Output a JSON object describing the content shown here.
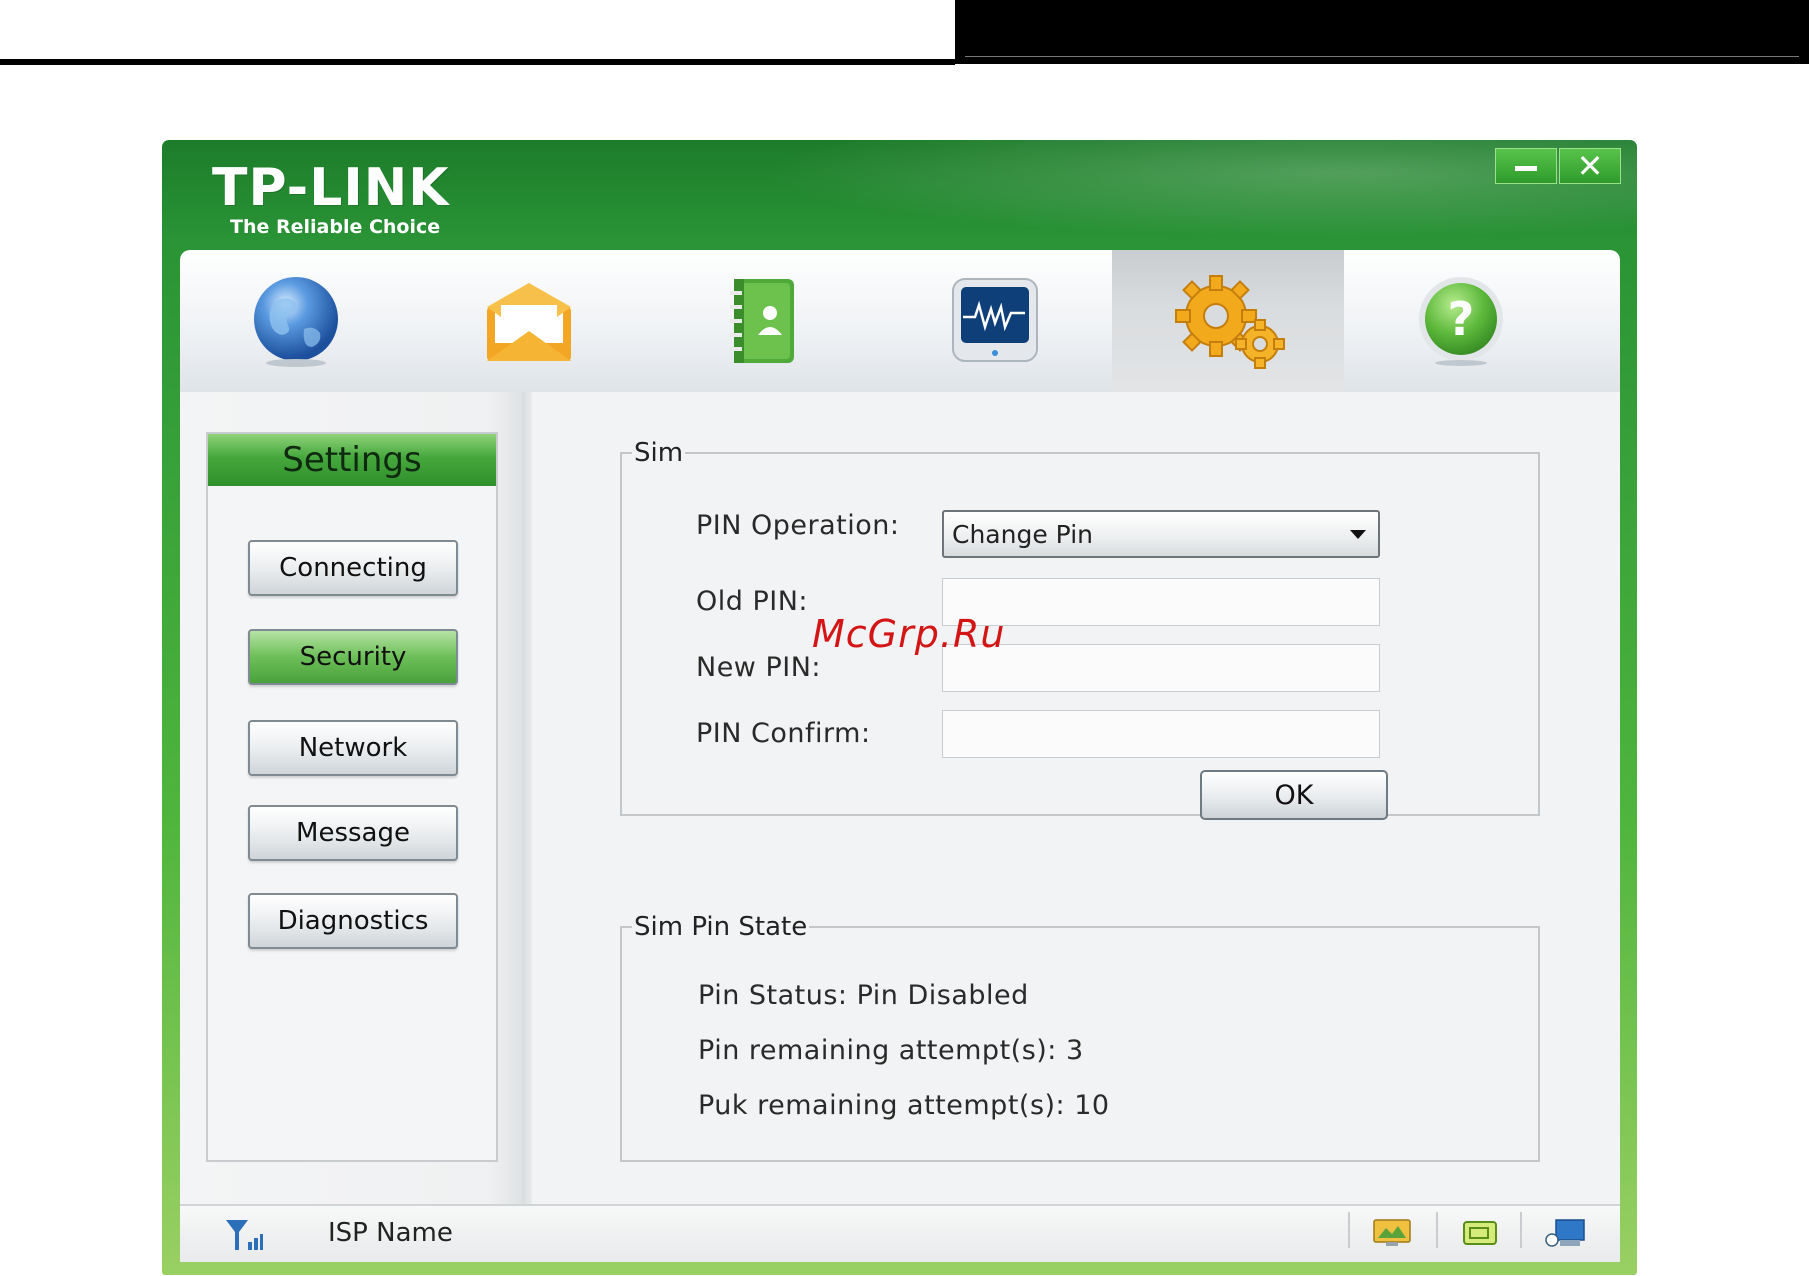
{
  "app": {
    "logo": "TP-LINK",
    "tagline": "The Reliable Choice"
  },
  "toolbar": {
    "items": [
      {
        "icon": "globe-icon",
        "active": false
      },
      {
        "icon": "envelope-icon",
        "active": false
      },
      {
        "icon": "phonebook-icon",
        "active": false
      },
      {
        "icon": "monitor-icon",
        "active": false
      },
      {
        "icon": "gears-icon",
        "active": true
      },
      {
        "icon": "help-icon",
        "active": false
      }
    ]
  },
  "sidebar": {
    "title": "Settings",
    "items": [
      {
        "label": "Connecting",
        "active": false
      },
      {
        "label": "Security",
        "active": true
      },
      {
        "label": "Network",
        "active": false
      },
      {
        "label": "Message",
        "active": false
      },
      {
        "label": "Diagnostics",
        "active": false
      }
    ]
  },
  "sim": {
    "legend": "Sim",
    "pin_operation_label": "PIN Operation:",
    "pin_operation_value": "Change Pin",
    "old_pin_label": "Old PIN:",
    "new_pin_label": "New PIN:",
    "pin_confirm_label": "PIN Confirm:",
    "ok_label": "OK"
  },
  "sim_state": {
    "legend": "Sim Pin State",
    "status_line": "Pin Status: Pin Disabled",
    "pin_remaining_line": "Pin remaining attempt(s): 3",
    "puk_remaining_line": "Puk remaining attempt(s): 10"
  },
  "status_bar": {
    "isp_name": "ISP Name"
  },
  "watermark": "McGrp.Ru",
  "colors": {
    "brand_green": "#2a9436",
    "active_nav_green": "#6cbf58",
    "watermark_red": "#d31515"
  }
}
